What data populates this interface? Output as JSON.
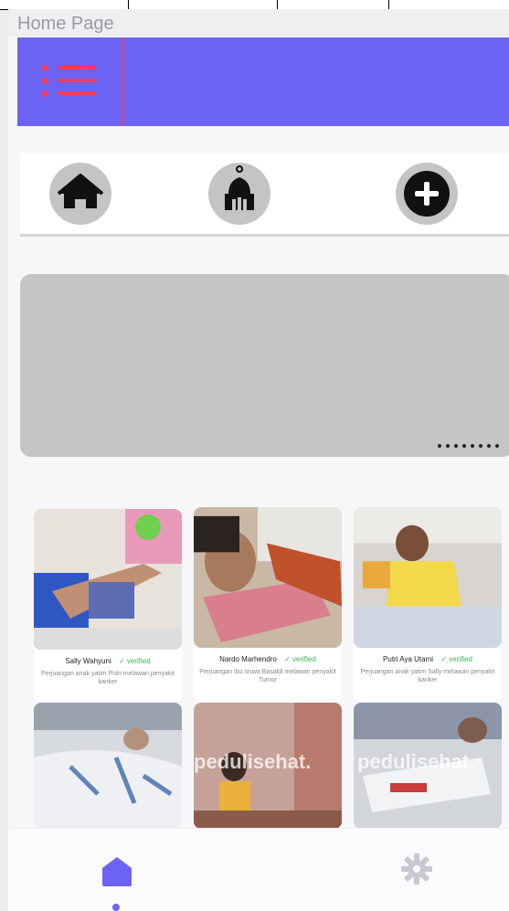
{
  "app": {
    "window_title": "Home Page"
  },
  "app_bar": {
    "color": "#6c63f5",
    "accent": "#f03c5a",
    "menu_icon": "menu-list-icon"
  },
  "quick_menu": [
    {
      "icon": "home-icon"
    },
    {
      "icon": "mosque-icon"
    },
    {
      "icon": "add-circle-icon"
    }
  ],
  "banner": {
    "page_dots": 8
  },
  "campaigns": [
    {
      "name": "Sally Wahyuni",
      "badge": "✓ verified",
      "description": "Perjuangan anak yatim Putri melawan penyakit kanker"
    },
    {
      "name": "Nardo Marhendro",
      "badge": "✓ verified",
      "description": "Perjuangan ibu siswa Basaldi melawan penyakit Tumor"
    },
    {
      "name": "Putri Aya Utami",
      "badge": "✓ verified",
      "description": "Perjuangan anak yatim Sally melawan penyakit kanker"
    },
    {
      "watermark": ""
    },
    {
      "watermark": "pedulisehat."
    },
    {
      "watermark": "pedulisehat."
    }
  ],
  "bottom_nav": {
    "items": [
      {
        "icon": "home-icon",
        "active": true
      },
      {
        "icon": "gear-icon",
        "active": false
      }
    ],
    "active_color": "#6c63f5",
    "inactive_color": "#c8c8d4"
  }
}
